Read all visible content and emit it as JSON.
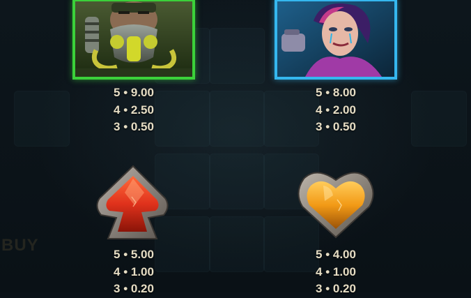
{
  "background": {
    "buy_label": "BUY"
  },
  "symbols": [
    {
      "name": "gas-mask-soldier",
      "frame_color": "#3bd13a",
      "payouts": [
        "5 • 9.00",
        "4 • 2.50",
        "3 • 0.50"
      ]
    },
    {
      "name": "punk-woman",
      "frame_color": "#35b7ef",
      "payouts": [
        "5 • 8.00",
        "4 • 2.00",
        "3 • 0.50"
      ]
    },
    {
      "name": "red-spade-gem",
      "color": "#e0321c",
      "payouts": [
        "5 • 5.00",
        "4 • 1.00",
        "3 • 0.20"
      ]
    },
    {
      "name": "orange-heart-gem",
      "color": "#f29a16",
      "payouts": [
        "5 • 4.00",
        "4 • 1.00",
        "3 • 0.20"
      ]
    }
  ]
}
